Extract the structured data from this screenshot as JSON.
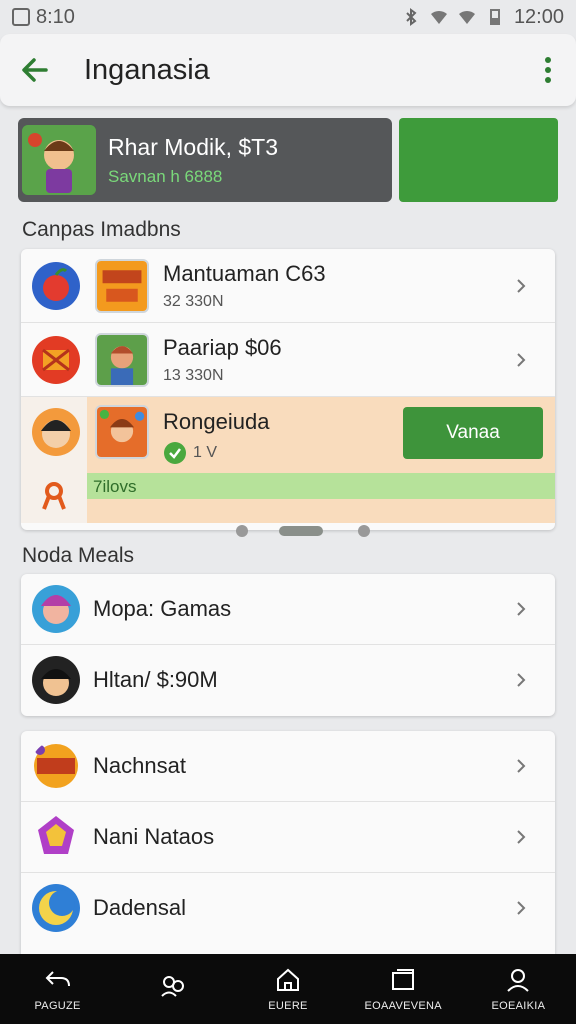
{
  "status_bar": {
    "left_text": "8:10",
    "time": "12:00"
  },
  "app_bar": {
    "title": "Inganasia"
  },
  "banner": {
    "title": "Rhar Modik, $T3",
    "subtitle": "Savnan h 6888"
  },
  "section_featured": {
    "title": "Canpas Imadbns"
  },
  "featured_items": [
    {
      "title": "Mantuaman C63",
      "subtitle": "32 330N"
    },
    {
      "title": "Paariap $06",
      "subtitle": "13 330N"
    },
    {
      "title": "Rongeiuda",
      "subtitle": "1 V",
      "button_label": "Vanaa",
      "progress_label": "7ilovs",
      "progress": 1.0
    }
  ],
  "section_more": {
    "title": "Noda Meals"
  },
  "more_items": [
    {
      "label": "Mopa: Gamas"
    },
    {
      "label": "Hltan/ $:90M"
    }
  ],
  "other_items": [
    {
      "label": "Nachnsat"
    },
    {
      "label": "Nani Nataos"
    },
    {
      "label": "Dadensal"
    }
  ],
  "bottom_nav": [
    {
      "label": "PAGUZE",
      "icon": "back-arrow-icon"
    },
    {
      "label": "",
      "icon": "people-icon"
    },
    {
      "label": "EUERE",
      "icon": "home-icon"
    },
    {
      "label": "EOAAVEVENA",
      "icon": "folder-icon"
    },
    {
      "label": "EOEAIKIA",
      "icon": "profile-icon"
    }
  ],
  "colors": {
    "accent": "#3e9b3b",
    "highlight": "#f9dcbd",
    "progress": "#b6e29a"
  }
}
